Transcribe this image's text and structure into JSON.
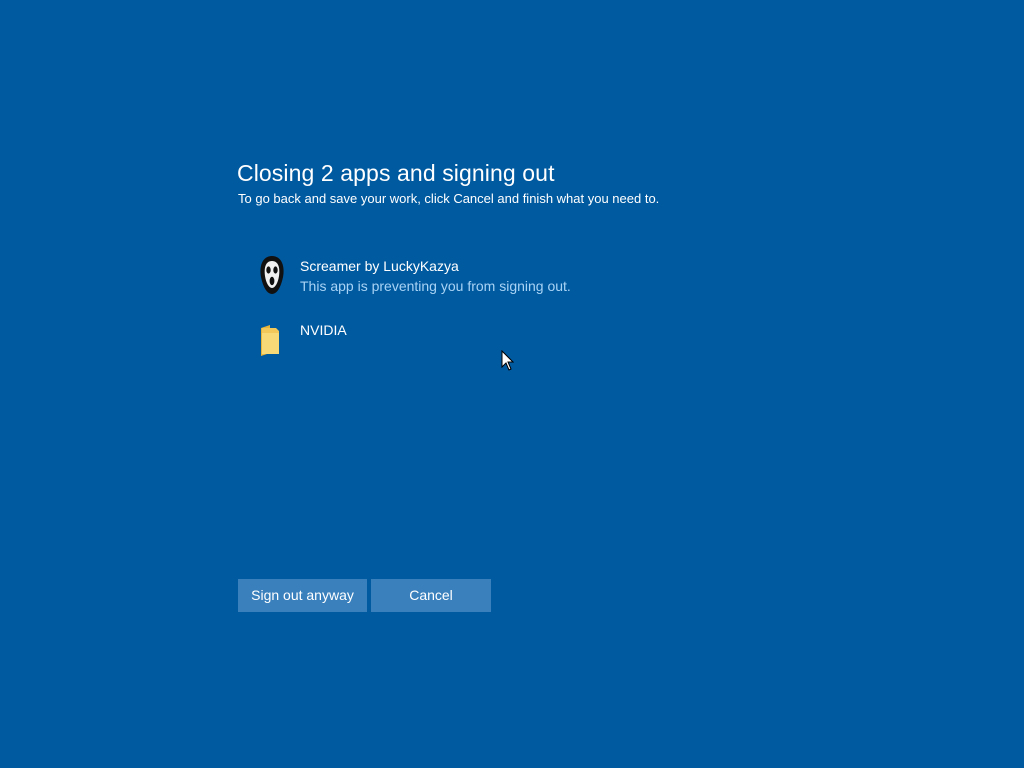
{
  "dialog": {
    "title": "Closing 2 apps and signing out",
    "subtitle": "To go back and save your work, click Cancel and finish what you need to."
  },
  "apps": [
    {
      "name": "Screamer by LuckyKazya",
      "status": "This app is preventing you from signing out.",
      "icon": "scream-mask-icon"
    },
    {
      "name": "NVIDIA",
      "status": "",
      "icon": "folder-icon"
    }
  ],
  "buttons": {
    "sign_out": "Sign out anyway",
    "cancel": "Cancel"
  },
  "colors": {
    "background": "#005aa0",
    "button": "#3a80bd",
    "status_text": "#a8d3f5",
    "folder": "#f2c85a"
  }
}
